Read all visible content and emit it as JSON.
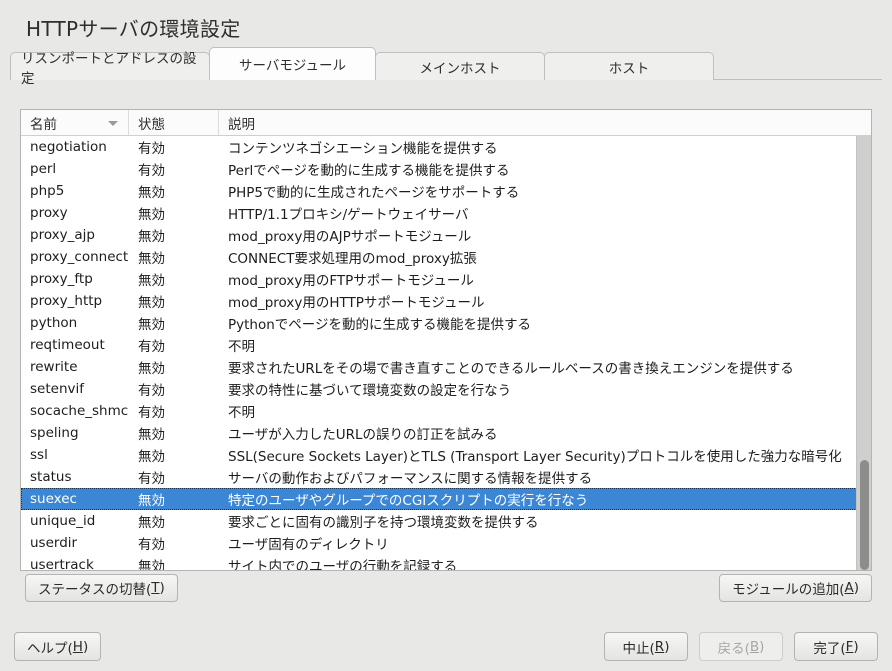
{
  "window": {
    "title": "HTTPサーバの環境設定"
  },
  "tabs": [
    {
      "label": "リスンポートとアドレスの設定",
      "active": false
    },
    {
      "label": "サーバモジュール",
      "active": true
    },
    {
      "label": "メインホスト",
      "active": false
    },
    {
      "label": "ホスト",
      "active": false
    }
  ],
  "table": {
    "columns": [
      {
        "key": "name",
        "label": "名前",
        "sort": "descending"
      },
      {
        "key": "state",
        "label": "状態"
      },
      {
        "key": "desc",
        "label": "説明"
      }
    ],
    "rows": [
      {
        "name": "negotiation",
        "state": "有効",
        "desc": "コンテンツネゴシエーション機能を提供する",
        "selected": false
      },
      {
        "name": "perl",
        "state": "有効",
        "desc": "Perlでページを動的に生成する機能を提供する",
        "selected": false
      },
      {
        "name": "php5",
        "state": "無効",
        "desc": "PHP5で動的に生成されたページをサポートする",
        "selected": false
      },
      {
        "name": "proxy",
        "state": "無効",
        "desc": "HTTP/1.1プロキシ/ゲートウェイサーバ",
        "selected": false
      },
      {
        "name": "proxy_ajp",
        "state": "無効",
        "desc": "mod_proxy用のAJPサポートモジュール",
        "selected": false
      },
      {
        "name": "proxy_connect",
        "state": "無効",
        "desc": "CONNECT要求処理用のmod_proxy拡張",
        "selected": false
      },
      {
        "name": "proxy_ftp",
        "state": "無効",
        "desc": "mod_proxy用のFTPサポートモジュール",
        "selected": false
      },
      {
        "name": "proxy_http",
        "state": "無効",
        "desc": "mod_proxy用のHTTPサポートモジュール",
        "selected": false
      },
      {
        "name": "python",
        "state": "無効",
        "desc": "Pythonでページを動的に生成する機能を提供する",
        "selected": false
      },
      {
        "name": "reqtimeout",
        "state": "有効",
        "desc": "不明",
        "selected": false
      },
      {
        "name": "rewrite",
        "state": "無効",
        "desc": "要求されたURLをその場で書き直すことのできるルールベースの書き換えエンジンを提供する",
        "selected": false
      },
      {
        "name": "setenvif",
        "state": "有効",
        "desc": "要求の特性に基づいて環境変数の設定を行なう",
        "selected": false
      },
      {
        "name": "socache_shmcb",
        "state": "有効",
        "desc": "不明",
        "selected": false
      },
      {
        "name": "speling",
        "state": "無効",
        "desc": "ユーザが入力したURLの誤りの訂正を試みる",
        "selected": false
      },
      {
        "name": "ssl",
        "state": "無効",
        "desc": "SSL(Secure Sockets Layer)とTLS (Transport Layer Security)プロトコルを使用した強力な暗号化",
        "selected": false
      },
      {
        "name": "status",
        "state": "有効",
        "desc": "サーバの動作およびパフォーマンスに関する情報を提供する",
        "selected": false
      },
      {
        "name": "suexec",
        "state": "無効",
        "desc": "特定のユーザやグループでのCGIスクリプトの実行を行なう",
        "selected": true
      },
      {
        "name": "unique_id",
        "state": "無効",
        "desc": "要求ごとに固有の識別子を持つ環境変数を提供する",
        "selected": false
      },
      {
        "name": "userdir",
        "state": "有効",
        "desc": "ユーザ固有のディレクトリ",
        "selected": false
      },
      {
        "name": "usertrack",
        "state": "無効",
        "desc": "サイト内でのユーザの行動を記録する",
        "selected": false
      }
    ]
  },
  "actions": {
    "toggle_status": {
      "text": "ステータスの切替(",
      "accel": "T",
      "text_end": ")"
    },
    "add_module": {
      "text": "モジュールの追加(",
      "accel": "A",
      "text_end": ")"
    }
  },
  "footer": {
    "help": {
      "text": "ヘルプ(",
      "accel": "H",
      "text_end": ")"
    },
    "cancel": {
      "text": "中止(",
      "accel": "R",
      "text_end": ")"
    },
    "back": {
      "text": "戻る(",
      "accel": "B",
      "text_end": ")",
      "disabled": true
    },
    "finish": {
      "text": "完了(",
      "accel": "F",
      "text_end": ")"
    }
  },
  "colors": {
    "selection": "#3b87d6",
    "window_bg": "#e8e8e6",
    "list_bg": "#ffffff"
  }
}
